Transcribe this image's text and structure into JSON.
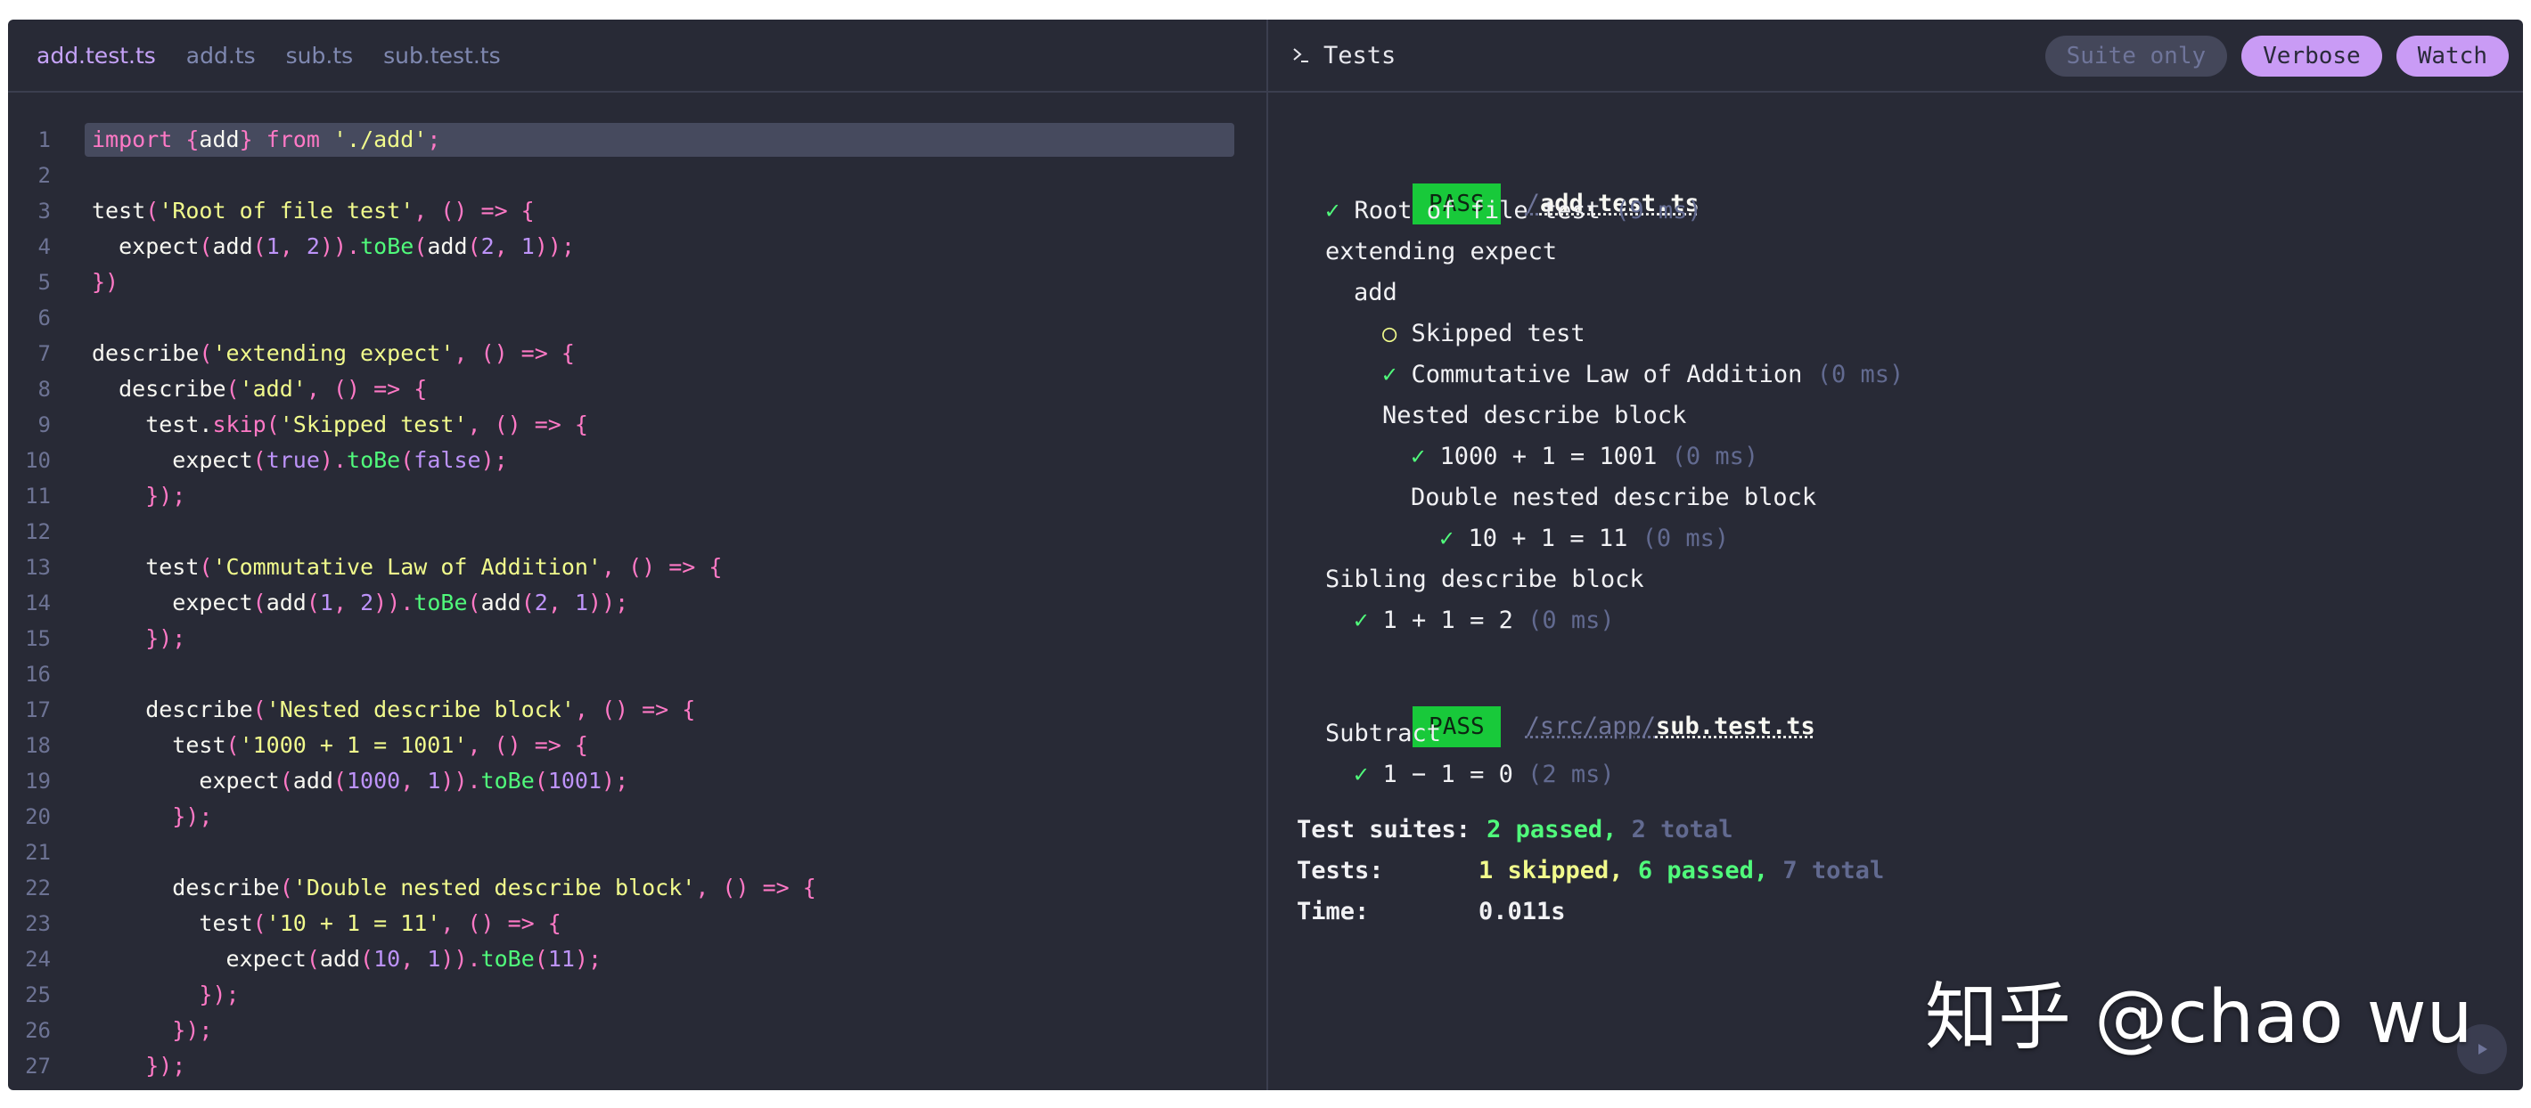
{
  "editor": {
    "tabs": [
      {
        "label": "add.test.ts",
        "active": true
      },
      {
        "label": "add.ts",
        "active": false
      },
      {
        "label": "sub.ts",
        "active": false
      },
      {
        "label": "sub.test.ts",
        "active": false
      }
    ],
    "line_numbers": [
      "1",
      "2",
      "3",
      "4",
      "5",
      "6",
      "7",
      "8",
      "9",
      "10",
      "11",
      "12",
      "13",
      "14",
      "15",
      "16",
      "17",
      "18",
      "19",
      "20",
      "21",
      "22",
      "23",
      "24",
      "25",
      "26",
      "27"
    ],
    "lines": [
      [
        [
          "kw",
          "import "
        ],
        [
          "p",
          "{"
        ],
        [
          "id",
          "add"
        ],
        [
          "p",
          "} "
        ],
        [
          "kw",
          "from "
        ],
        [
          "str",
          "'./add'"
        ],
        [
          "p",
          ";"
        ]
      ],
      [],
      [
        [
          "id",
          "test"
        ],
        [
          "p",
          "("
        ],
        [
          "str",
          "'Root of file test'"
        ],
        [
          "p",
          ", () => {"
        ]
      ],
      [
        [
          "id",
          "  expect"
        ],
        [
          "p",
          "("
        ],
        [
          "id",
          "add"
        ],
        [
          "p",
          "("
        ],
        [
          "num",
          "1"
        ],
        [
          "p",
          ", "
        ],
        [
          "num",
          "2"
        ],
        [
          "p",
          "))."
        ],
        [
          "mth",
          "toBe"
        ],
        [
          "p",
          "("
        ],
        [
          "id",
          "add"
        ],
        [
          "p",
          "("
        ],
        [
          "num",
          "2"
        ],
        [
          "p",
          ", "
        ],
        [
          "num",
          "1"
        ],
        [
          "p",
          "));"
        ]
      ],
      [
        [
          "p",
          "})"
        ]
      ],
      [],
      [
        [
          "id",
          "describe"
        ],
        [
          "p",
          "("
        ],
        [
          "str",
          "'extending expect'"
        ],
        [
          "p",
          ", () => {"
        ]
      ],
      [
        [
          "id",
          "  describe"
        ],
        [
          "p",
          "("
        ],
        [
          "str",
          "'add'"
        ],
        [
          "p",
          ", () => {"
        ]
      ],
      [
        [
          "id",
          "    test."
        ],
        [
          "sk",
          "skip"
        ],
        [
          "p",
          "("
        ],
        [
          "str",
          "'Skipped test'"
        ],
        [
          "p",
          ", () => {"
        ]
      ],
      [
        [
          "id",
          "      expect"
        ],
        [
          "p",
          "("
        ],
        [
          "num",
          "true"
        ],
        [
          "p",
          ")."
        ],
        [
          "mth",
          "toBe"
        ],
        [
          "p",
          "("
        ],
        [
          "num",
          "false"
        ],
        [
          "p",
          ");"
        ]
      ],
      [
        [
          "p",
          "    });"
        ]
      ],
      [],
      [
        [
          "id",
          "    test"
        ],
        [
          "p",
          "("
        ],
        [
          "str",
          "'Commutative Law of Addition'"
        ],
        [
          "p",
          ", () => {"
        ]
      ],
      [
        [
          "id",
          "      expect"
        ],
        [
          "p",
          "("
        ],
        [
          "id",
          "add"
        ],
        [
          "p",
          "("
        ],
        [
          "num",
          "1"
        ],
        [
          "p",
          ", "
        ],
        [
          "num",
          "2"
        ],
        [
          "p",
          "))."
        ],
        [
          "mth",
          "toBe"
        ],
        [
          "p",
          "("
        ],
        [
          "id",
          "add"
        ],
        [
          "p",
          "("
        ],
        [
          "num",
          "2"
        ],
        [
          "p",
          ", "
        ],
        [
          "num",
          "1"
        ],
        [
          "p",
          "));"
        ]
      ],
      [
        [
          "p",
          "    });"
        ]
      ],
      [],
      [
        [
          "id",
          "    describe"
        ],
        [
          "p",
          "("
        ],
        [
          "str",
          "'Nested describe block'"
        ],
        [
          "p",
          ", () => {"
        ]
      ],
      [
        [
          "id",
          "      test"
        ],
        [
          "p",
          "("
        ],
        [
          "str",
          "'1000 + 1 = 1001'"
        ],
        [
          "p",
          ", () => {"
        ]
      ],
      [
        [
          "id",
          "        expect"
        ],
        [
          "p",
          "("
        ],
        [
          "id",
          "add"
        ],
        [
          "p",
          "("
        ],
        [
          "num",
          "1000"
        ],
        [
          "p",
          ", "
        ],
        [
          "num",
          "1"
        ],
        [
          "p",
          "))."
        ],
        [
          "mth",
          "toBe"
        ],
        [
          "p",
          "("
        ],
        [
          "num",
          "1001"
        ],
        [
          "p",
          ");"
        ]
      ],
      [
        [
          "p",
          "      });"
        ]
      ],
      [],
      [
        [
          "id",
          "      describe"
        ],
        [
          "p",
          "("
        ],
        [
          "str",
          "'Double nested describe block'"
        ],
        [
          "p",
          ", () => {"
        ]
      ],
      [
        [
          "id",
          "        test"
        ],
        [
          "p",
          "("
        ],
        [
          "str",
          "'10 + 1 = 11'"
        ],
        [
          "p",
          ", () => {"
        ]
      ],
      [
        [
          "id",
          "          expect"
        ],
        [
          "p",
          "("
        ],
        [
          "id",
          "add"
        ],
        [
          "p",
          "("
        ],
        [
          "num",
          "10"
        ],
        [
          "p",
          ", "
        ],
        [
          "num",
          "1"
        ],
        [
          "p",
          "))."
        ],
        [
          "mth",
          "toBe"
        ],
        [
          "p",
          "("
        ],
        [
          "num",
          "11"
        ],
        [
          "p",
          ");"
        ]
      ],
      [
        [
          "p",
          "        });"
        ]
      ],
      [
        [
          "p",
          "      });"
        ]
      ],
      [
        [
          "p",
          "    });"
        ]
      ]
    ]
  },
  "tests": {
    "title": "Tests",
    "buttons": {
      "suite_only": "Suite only",
      "verbose": "Verbose",
      "watch": "Watch"
    },
    "suite1": {
      "badge": "PASS",
      "path": "/",
      "file": "add.test.ts",
      "root_test": "Root of file test",
      "root_ms": "(9 ms)",
      "describe1": "extending expect",
      "describe2": "add",
      "skipped": "Skipped test",
      "comm": "Commutative Law of Addition",
      "comm_ms": "(0 ms)",
      "nested": "Nested describe block",
      "t1000": "1000 + 1 = 1001",
      "t1000_ms": "(0 ms)",
      "double": "Double nested describe block",
      "t10": "10 + 1 = 11",
      "t10_ms": "(0 ms)",
      "sibling": "Sibling describe block",
      "t11": "1 + 1 = 2",
      "t11_ms": "(0 ms)"
    },
    "suite2": {
      "badge": "PASS",
      "path": "/src/app/",
      "file": "sub.test.ts",
      "describe": "Subtract",
      "t": "1 − 1 = 0",
      "t_ms": "(2 ms)"
    },
    "check": "✓",
    "circle": "○",
    "summary": {
      "suites_label": "Test suites:",
      "suites_passed": "2 passed,",
      "suites_total": "2 total",
      "tests_label": "Tests:",
      "tests_skipped": "1 skipped,",
      "tests_passed": "6 passed,",
      "tests_total": "7 total",
      "time_label": "Time:",
      "time_value": "0.011s"
    }
  },
  "watermark": "知乎 @chao wu"
}
